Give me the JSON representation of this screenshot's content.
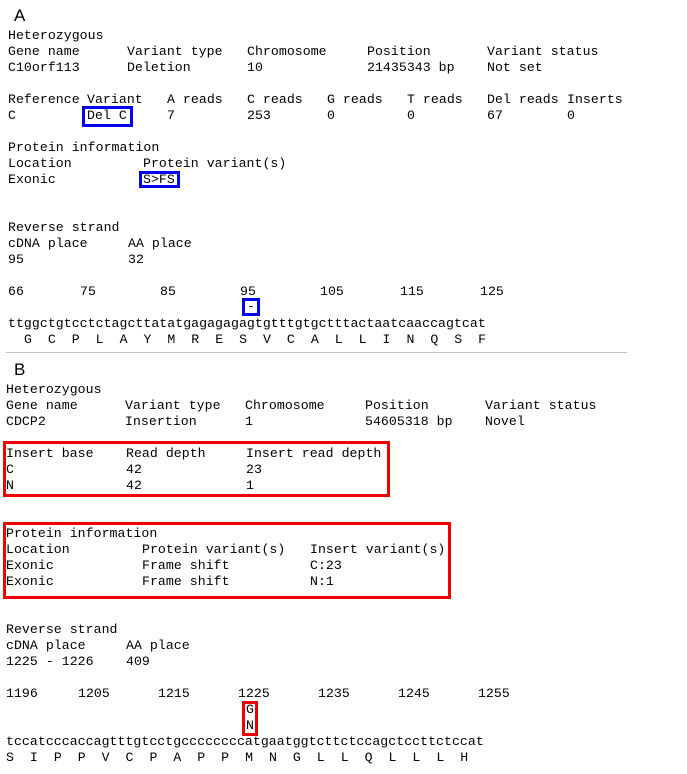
{
  "panel_a": {
    "label": "A",
    "zygosity": "Heterozygous",
    "header": {
      "gene_name_label": "Gene name",
      "variant_type_label": "Variant type",
      "chromosome_label": "Chromosome",
      "position_label": "Position",
      "variant_status_label": "Variant status",
      "gene_name": "C10orf113",
      "variant_type": "Deletion",
      "chromosome": "10",
      "position": "21435343 bp",
      "variant_status": "Not set"
    },
    "reads": {
      "headers": [
        "Reference",
        "Variant",
        "A reads",
        "C reads",
        "G reads",
        "T reads",
        "Del reads",
        "Inserts"
      ],
      "values": [
        "C",
        "Del C",
        "7",
        "253",
        "0",
        "0",
        "67",
        "0"
      ]
    },
    "protein": {
      "title": "Protein information",
      "location_label": "Location",
      "protein_variant_label": "Protein variant(s)",
      "location": "Exonic",
      "protein_variant": "S>FS"
    },
    "strand": {
      "title": "Reverse strand",
      "cdna_label": "cDNA place",
      "aa_label": "AA place",
      "cdna": "95",
      "aa": "32"
    },
    "ruler": [
      "66",
      "75",
      "85",
      "95",
      "105",
      "115",
      "125"
    ],
    "deletion_marker": "-",
    "dna": "ttggctgtcctctagcttatatgagagagagtgtttgtgctttactaatcaaccagtcat",
    "aa_sequence": [
      "G",
      "C",
      "P",
      "L",
      "A",
      "Y",
      "M",
      "R",
      "E",
      "S",
      "V",
      "C",
      "A",
      "L",
      "L",
      "I",
      "N",
      "Q",
      "S",
      "F"
    ]
  },
  "panel_b": {
    "label": "B",
    "zygosity": "Heterozygous",
    "header": {
      "gene_name_label": "Gene name",
      "variant_type_label": "Variant type",
      "chromosome_label": "Chromosome",
      "position_label": "Position",
      "variant_status_label": "Variant status",
      "gene_name": "CDCP2",
      "variant_type": "Insertion",
      "chromosome": "1",
      "position": "54605318 bp",
      "variant_status": "Novel"
    },
    "inserts": {
      "headers": [
        "Insert base",
        "Read depth",
        "Insert read depth"
      ],
      "rows": [
        [
          "C",
          "42",
          "23"
        ],
        [
          "N",
          "42",
          "1"
        ]
      ]
    },
    "protein": {
      "title": "Protein information",
      "headers": [
        "Location",
        "Protein variant(s)",
        "Insert variant(s)"
      ],
      "rows": [
        [
          "Exonic",
          "Frame shift",
          "C:23"
        ],
        [
          "Exonic",
          "Frame shift",
          "N:1"
        ]
      ]
    },
    "strand": {
      "title": "Reverse strand",
      "cdna_label": "cDNA place",
      "aa_label": "AA place",
      "cdna": "1225 - 1226",
      "aa": "409"
    },
    "ruler": [
      "1196",
      "1205",
      "1215",
      "1225",
      "1235",
      "1245",
      "1255"
    ],
    "insert_markers": [
      "G",
      "N"
    ],
    "dna": "tccatcccaccagtttgtcctgccccccccatgaatggtcttctccagctccttctccat",
    "aa_sequence": [
      "S",
      "I",
      "P",
      "P",
      "V",
      "C",
      "P",
      "A",
      "P",
      "P",
      "M",
      "N",
      "G",
      "L",
      "L",
      "Q",
      "L",
      "L",
      "L",
      "H"
    ]
  },
  "colors": {
    "highlight_blue": "#0000ee",
    "highlight_red": "#ee0000",
    "divider": "#c0c0c0"
  }
}
